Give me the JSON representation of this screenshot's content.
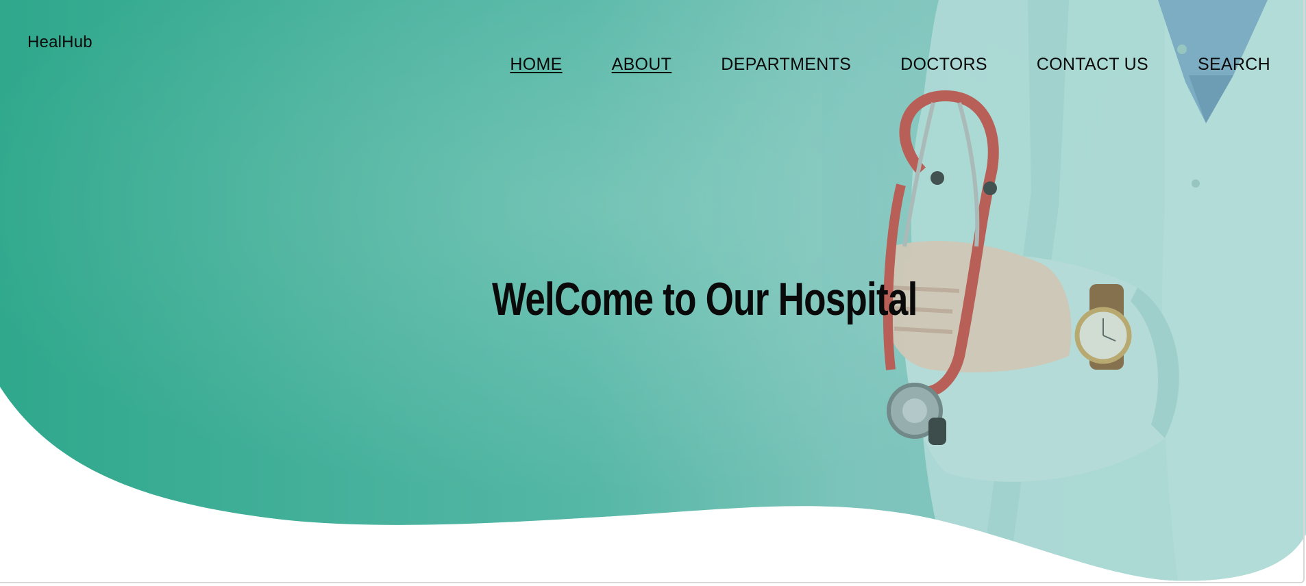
{
  "brand": {
    "name": "HealHub"
  },
  "nav": {
    "items": [
      {
        "label": "HOME"
      },
      {
        "label": "ABOUT"
      },
      {
        "label": "DEPARTMENTS"
      },
      {
        "label": "DOCTORS"
      },
      {
        "label": "CONTACT US"
      },
      {
        "label": "SEARCH"
      }
    ]
  },
  "hero": {
    "headline": "WelCome to Our Hospital",
    "image": "doctor-with-stethoscope-photo"
  },
  "colors": {
    "hero_teal": "#3cae97",
    "hero_teal_light": "#8cc9c2",
    "coat": "#bfe0dc",
    "stethoscope_red": "#c9443a"
  }
}
